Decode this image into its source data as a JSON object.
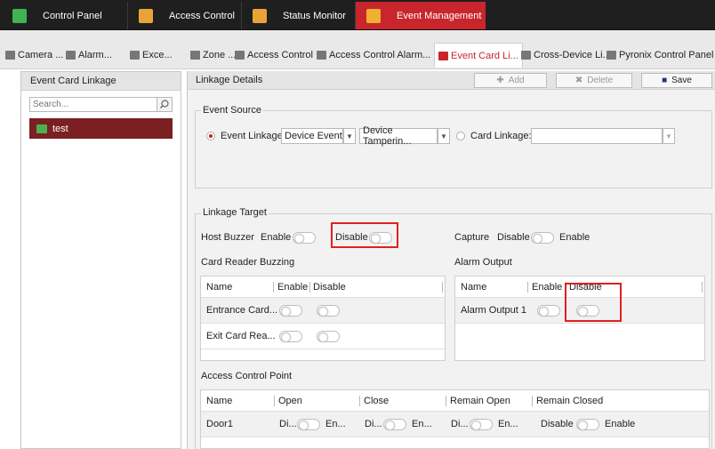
{
  "top_tabs": [
    {
      "label": "Control Panel",
      "icon": "control-panel-icon"
    },
    {
      "label": "Access Control",
      "icon": "access-control-icon"
    },
    {
      "label": "Status Monitor",
      "icon": "status-monitor-icon"
    },
    {
      "label": "Event Management",
      "icon": "event-management-icon",
      "active": true
    }
  ],
  "sub_tabs": [
    {
      "label": "Camera ..."
    },
    {
      "label": "Alarm..."
    },
    {
      "label": "Exce..."
    },
    {
      "label": "Zone ..."
    },
    {
      "label": "Access Control ..."
    },
    {
      "label": "Access Control Alarm..."
    },
    {
      "label": "Event Card Li...",
      "active": true
    },
    {
      "label": "Cross-Device Li..."
    },
    {
      "label": "Pyronix Control Panel"
    }
  ],
  "left_panel": {
    "title": "Event Card Linkage",
    "search_placeholder": "Search...",
    "tree_items": [
      {
        "label": "test"
      }
    ]
  },
  "right_panel": {
    "title": "Linkage Details",
    "buttons": {
      "add": "Add",
      "delete": "Delete",
      "save": "Save"
    },
    "event_source": {
      "label": "Event Source",
      "event_linkage_label": "Event Linkage:",
      "event_type": "Device Event",
      "event_detail": "Device Tamperin...",
      "card_linkage_label": "Card Linkage:",
      "card_linkage_value": ""
    },
    "linkage_target": {
      "label": "Linkage Target",
      "host_buzzer": {
        "label": "Host Buzzer",
        "enable": "Enable",
        "disable": "Disable"
      },
      "capture": {
        "label": "Capture",
        "disable": "Disable",
        "enable": "Enable"
      },
      "card_reader_buzzing": {
        "label": "Card Reader Buzzing",
        "headers": [
          "Name",
          "Enable",
          "Disable"
        ],
        "rows": [
          {
            "name": "Entrance Card..."
          },
          {
            "name": "Exit Card Rea..."
          }
        ]
      },
      "alarm_output": {
        "label": "Alarm Output",
        "headers": [
          "Name",
          "Enable",
          "Disable"
        ],
        "rows": [
          {
            "name": "Alarm Output 1"
          }
        ]
      },
      "access_control_point": {
        "label": "Access Control Point",
        "headers": [
          "Name",
          "Open",
          "Close",
          "Remain Open",
          "Remain Closed"
        ],
        "rows": [
          {
            "name": "Door1",
            "open_left": "Di...",
            "open_right": "En...",
            "close_left": "Di...",
            "close_right": "En...",
            "remain_open_left": "Di...",
            "remain_open_right": "En...",
            "remain_closed_left": "Disable",
            "remain_closed_right": "Enable"
          }
        ]
      }
    }
  },
  "colors": {
    "accent": "#c8262c",
    "highlight_box": "#e0211f",
    "selected_tree": "#7a1f22"
  }
}
